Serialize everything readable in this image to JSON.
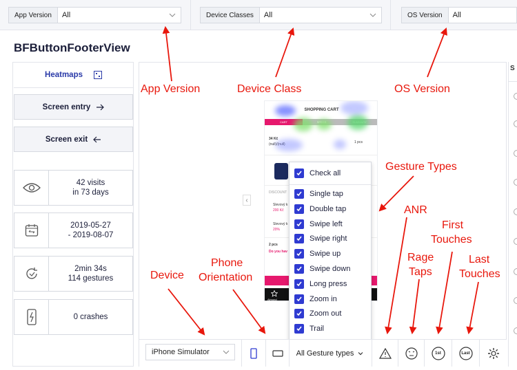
{
  "filters": [
    {
      "label": "App Version",
      "value": "All"
    },
    {
      "label": "Device Classes",
      "value": "All"
    },
    {
      "label": "OS Version",
      "value": "All"
    }
  ],
  "page_title": "BFButtonFooterView",
  "left": {
    "heatmaps_label": "Heatmaps",
    "screen_entry_label": "Screen entry",
    "screen_exit_label": "Screen exit",
    "stats": [
      {
        "icon": "eye-icon",
        "line1": "42 visits",
        "line2": "in 73 days"
      },
      {
        "icon": "calendar-icon",
        "line1": "2019-05-27",
        "line2": "- 2019-08-07"
      },
      {
        "icon": "replay-icon",
        "line1": "2min 34s",
        "line2": "114 gestures"
      },
      {
        "icon": "phone-crash-icon",
        "line1": "0 crashes",
        "line2": ""
      }
    ]
  },
  "right_panel": {
    "header": "S"
  },
  "phone_screen": {
    "cart_title": "SHOPPING CART",
    "steps": [
      "CART",
      "SPECS",
      "SUMMARY"
    ],
    "item_price": "34 Kč",
    "item_sub": "(null)/(null)",
    "item_qty": "1 pcs",
    "discount_label": "DISCOUNT",
    "discount_1_title": "Slevový k",
    "discount_1_value": "200 Kč",
    "discount_2_title": "Slevový k",
    "discount_2_value": "20%",
    "summary_qty": "2 pcs",
    "summary_question": "Do you hav",
    "nav_label": "Almond"
  },
  "gesture_dropdown": {
    "check_all": "Check all",
    "items": [
      "Single tap",
      "Double tap",
      "Swipe left",
      "Swipe right",
      "Swipe up",
      "Swipe down",
      "Long press",
      "Zoom in",
      "Zoom out",
      "Trail"
    ]
  },
  "bottom_bar": {
    "device_value": "iPhone Simulator",
    "gesture_types_label": "All Gesture types",
    "first_label": "1st",
    "last_label": "Last"
  },
  "annotations": {
    "app_version": "App Version",
    "device_class": "Device Class",
    "os_version": "OS Version",
    "gesture_types": "Gesture Types",
    "anr": "ANR",
    "first_touches_1": "First",
    "first_touches_2": "Touches",
    "rage_taps_1": "Rage",
    "rage_taps_2": "Taps",
    "last_touches_1": "Last",
    "last_touches_2": "Touches",
    "device": "Device",
    "phone_orientation_1": "Phone",
    "phone_orientation_2": "Orientation"
  },
  "colors": {
    "accent": "#2f3bd1",
    "annotation": "#e8170c",
    "pink": "#e6186d"
  }
}
